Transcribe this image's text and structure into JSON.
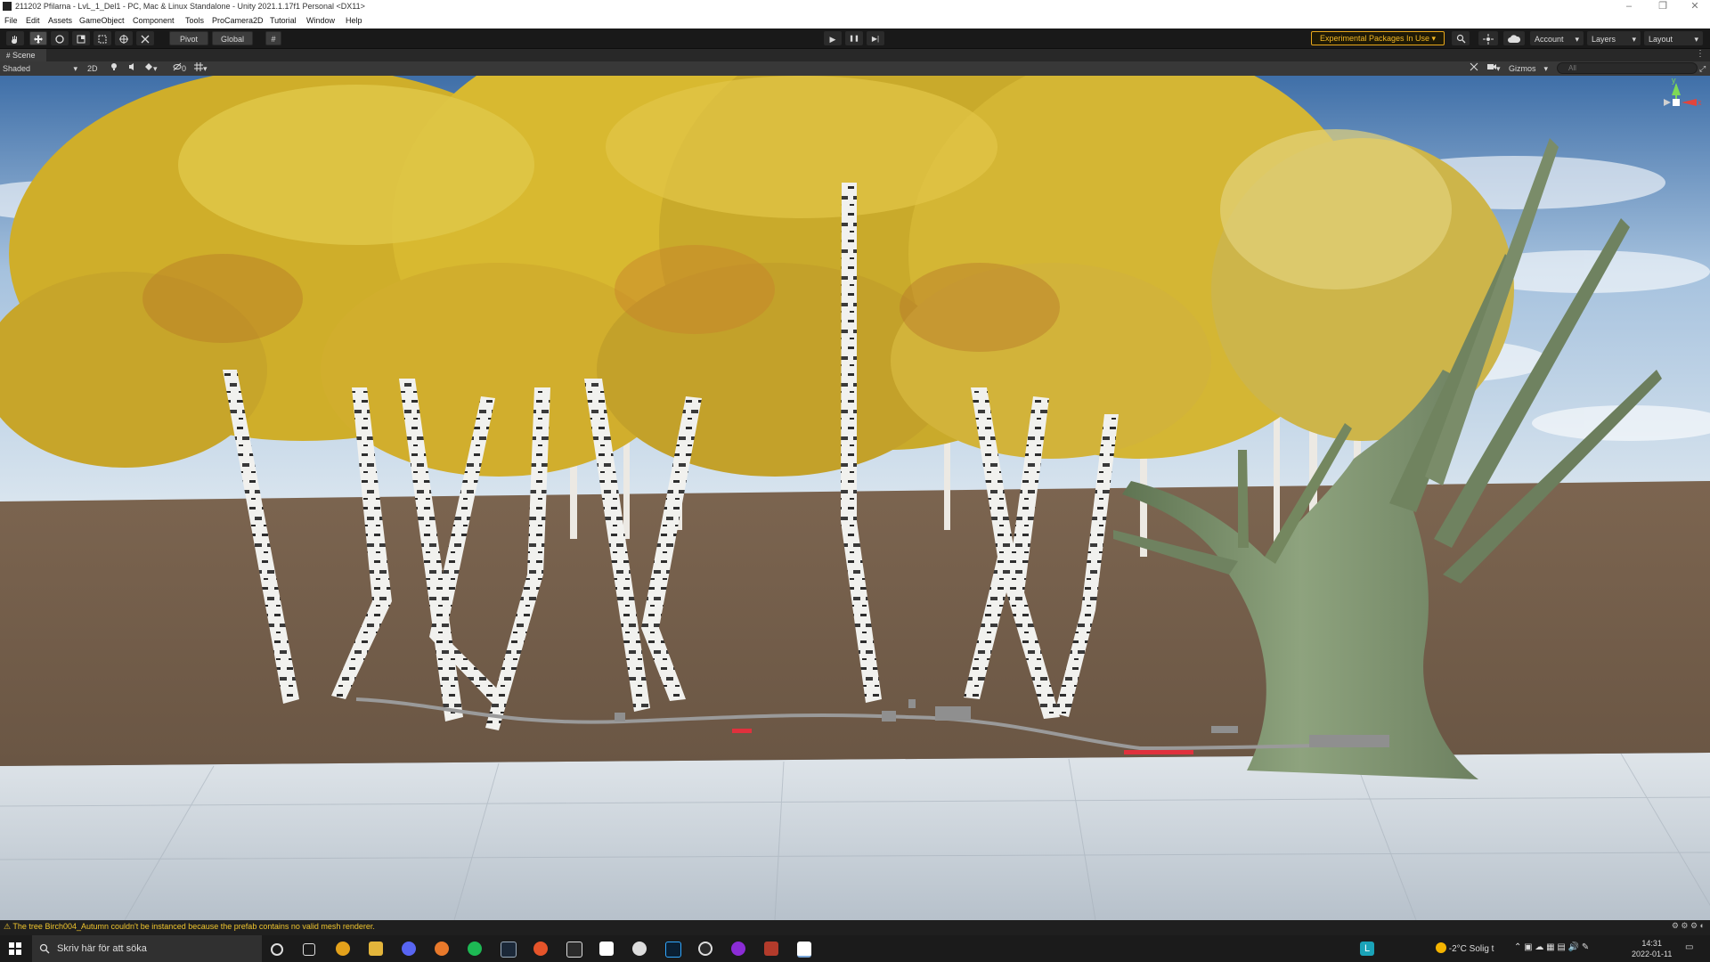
{
  "window": {
    "title": "211202 Pfilarna - LvL_1_Del1 - PC, Mac & Linux Standalone - Unity 2021.1.17f1 Personal <DX11>",
    "minimize": "–",
    "maximize": "❐",
    "close": "✕"
  },
  "menu": [
    "File",
    "Edit",
    "Assets",
    "GameObject",
    "Component",
    "Tools",
    "ProCamera2D",
    "Tutorial",
    "Window",
    "Help"
  ],
  "toolbar": {
    "tools": [
      "hand-icon",
      "move-icon",
      "rotate-icon",
      "scale-icon",
      "rect-icon",
      "transform-icon",
      "custom-tool-icon"
    ],
    "pivot": "Pivot",
    "global": "Global",
    "grid_snap": "#",
    "play": "▶",
    "pause": "❚❚",
    "step": "▶|",
    "experimental": "Experimental Packages In Use ▾",
    "account": "Account",
    "layers": "Layers",
    "layout": "Layout"
  },
  "scene_tab": {
    "label": "Scene"
  },
  "scene_toolbar": {
    "draw_mode": "Shaded",
    "mode_2d": "2D",
    "hidden_count": "0",
    "gizmos": "Gizmos",
    "search_placeholder": "All"
  },
  "gizmo_axes": {
    "y": "y",
    "x": "x"
  },
  "status": {
    "message": "The tree Birch004_Autumn couldn't be instanced because the prefab contains no valid mesh renderer."
  },
  "taskbar": {
    "search_placeholder": "Skriv här för att söka",
    "weather": "-2°C Solig t",
    "time": "14:31",
    "date": "2022-01-11",
    "lang_badge": "L"
  },
  "colors": {
    "experimental_border": "#e9a81a",
    "warning_text": "#f0c52e",
    "ground": "#7a654f",
    "sky": "#8fb6da",
    "foliage": "#d6b428",
    "floor": "#c6ced6"
  }
}
